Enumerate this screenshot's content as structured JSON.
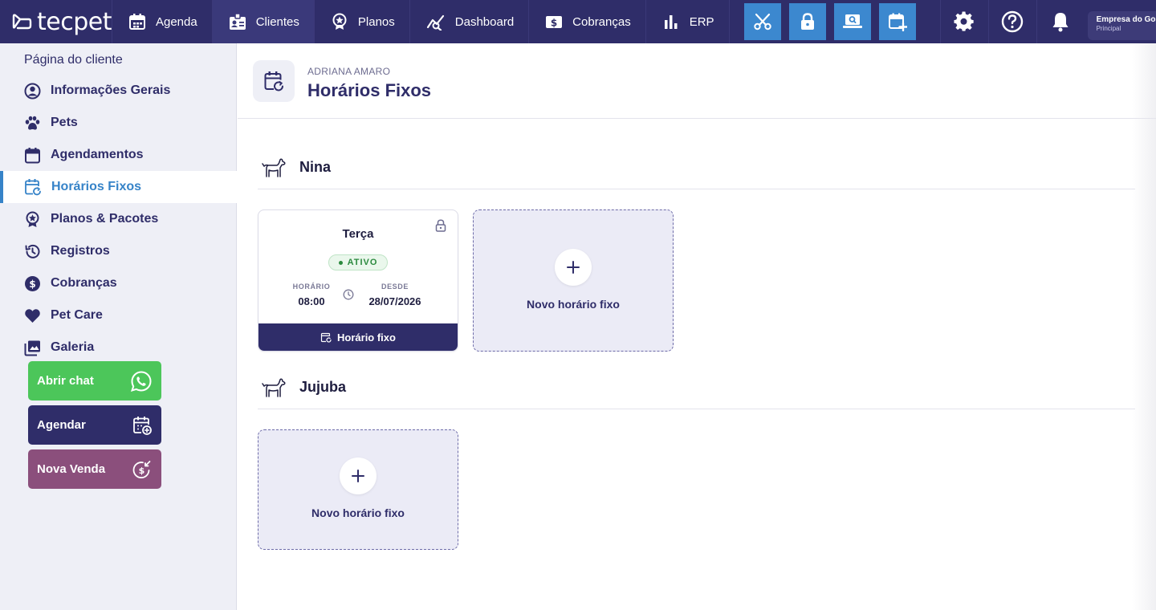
{
  "brand": {
    "name": "tecpet"
  },
  "nav": {
    "items": [
      {
        "label": "Agenda",
        "icon": "calendar-icon"
      },
      {
        "label": "Clientes",
        "icon": "client-card-icon",
        "active": true
      },
      {
        "label": "Planos",
        "icon": "ribbon-icon"
      },
      {
        "label": "Dashboard",
        "icon": "chart-line-icon"
      },
      {
        "label": "Cobranças",
        "icon": "dollar-icon"
      },
      {
        "label": "ERP",
        "icon": "bar-chart-icon"
      }
    ],
    "tools": [
      "scissors-icon",
      "lock-icon",
      "laptop-search-icon",
      "calendar-plus-icon"
    ],
    "right_icons": [
      "gear-icon",
      "help-icon",
      "bell-icon"
    ],
    "company": {
      "name": "Empresa do Gomes",
      "subtitle": "Principal"
    }
  },
  "sidebar": {
    "title": "Página do cliente",
    "items": [
      {
        "label": "Informações Gerais",
        "icon": "user-circle-icon"
      },
      {
        "label": "Pets",
        "icon": "paw-icon"
      },
      {
        "label": "Agendamentos",
        "icon": "calendar-icon"
      },
      {
        "label": "Horários Fixos",
        "icon": "calendar-repeat-icon",
        "active": true
      },
      {
        "label": "Planos & Pacotes",
        "icon": "ribbon-icon"
      },
      {
        "label": "Registros",
        "icon": "history-icon"
      },
      {
        "label": "Cobranças",
        "icon": "dollar-circle-icon"
      },
      {
        "label": "Pet Care",
        "icon": "heart-icon"
      },
      {
        "label": "Galeria",
        "icon": "gallery-icon"
      }
    ],
    "actions": [
      {
        "label": "Abrir chat",
        "icon": "whatsapp-icon",
        "color": "#4cc65a"
      },
      {
        "label": "Agendar",
        "icon": "calendar-add-icon",
        "color": "#2f2d69"
      },
      {
        "label": "Nova Venda",
        "icon": "money-refresh-icon",
        "color": "#8b4f7c"
      }
    ]
  },
  "header": {
    "client_name": "ADRIANA AMARO",
    "title": "Horários Fixos"
  },
  "pets": [
    {
      "name": "Nina",
      "schedules": [
        {
          "day": "Terça",
          "status": "ATIVO",
          "time_label": "HORÁRIO",
          "time": "08:00",
          "since_label": "DESDE",
          "since": "28/07/2026",
          "footer": "Horário fixo"
        }
      ],
      "new_label": "Novo horário fixo"
    },
    {
      "name": "Jujuba",
      "schedules": [],
      "new_label": "Novo horário fixo"
    }
  ],
  "colors": {
    "navy": "#2f2d69",
    "blue": "#3683c8",
    "tool_blue": "#3c88cf",
    "active_green": "#2b8a3e"
  }
}
